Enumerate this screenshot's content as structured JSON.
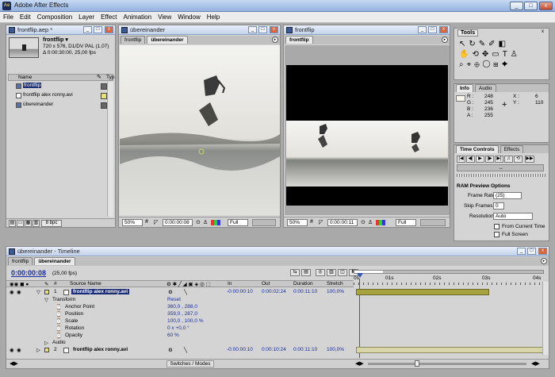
{
  "window": {
    "title": "Adobe After Effects",
    "icon": "ae-icon"
  },
  "menu": [
    "File",
    "Edit",
    "Composition",
    "Layer",
    "Effect",
    "Animation",
    "View",
    "Window",
    "Help"
  ],
  "project": {
    "title": "frontflip.aep *",
    "comp_name": "frontflip ▾",
    "info1": "720 x 576, D1/DV PAL (1,07)",
    "info2": "Δ 0:00:30:00, 25,00 fps",
    "col_name": "Name",
    "col_type": "Typ",
    "items": [
      "frontflip",
      "frontflip alex ronny.avi",
      "übereinander"
    ],
    "bpc": "8 bpc"
  },
  "comp1": {
    "title": "übereinander",
    "tabs": [
      "frontflip",
      "übereinander"
    ],
    "zoom": "50%",
    "timecode": "0:00:00:08",
    "res": "Full"
  },
  "comp2": {
    "title": "frontflip",
    "tabs": [
      "frontflip"
    ],
    "zoom": "50%",
    "timecode": "0:00:00:11",
    "res": "Full"
  },
  "tools": {
    "title": "Tools"
  },
  "info": {
    "tabs": [
      "Info",
      "Audio"
    ],
    "r": "R :",
    "rv": "248",
    "g": "G :",
    "gv": "245",
    "b": "B :",
    "bv": "236",
    "a": "A :",
    "av": "255",
    "x": "X :",
    "xv": "6",
    "y": "Y :",
    "yv": "110"
  },
  "time_controls": {
    "tabs": [
      "Time Controls",
      "Effects"
    ],
    "ram_title": "RAM Preview Options",
    "frame_rate_label": "Frame Rate:",
    "frame_rate": "(25)",
    "skip_label": "Skip Frames:",
    "skip": "0",
    "res_label": "Resolution:",
    "res": "Auto",
    "from_current": "From Current Time",
    "full_screen": "Full Screen"
  },
  "timeline": {
    "title": "übereinander - Timeline",
    "tabs": [
      "frontflip",
      "übereinander"
    ],
    "timecode": "0:00:00:08",
    "fps": "(25,00 fps)",
    "ruler": [
      "0s",
      "01s",
      "02s",
      "03s",
      "04s"
    ],
    "headers": {
      "num": "#",
      "src": "Source Name",
      "in": "In",
      "out": "Out",
      "dur": "Duration",
      "str": "Stretch"
    },
    "layers": [
      {
        "num": "1",
        "name": "frontflip alex ronny.avi",
        "in": "-0:00:00:10",
        "out": "0:00:02:24",
        "dur": "0:00:11:10",
        "str": "100,0%"
      },
      {
        "num": "2",
        "name": "frontflip alex ronny.avi",
        "in": "-0:00:00:10",
        "out": "0:00:10:24",
        "dur": "0:00:11:10",
        "str": "100,0%"
      }
    ],
    "transform": "Transform",
    "reset": "Reset",
    "props": [
      {
        "name": "Anchor Point",
        "value": "360,0 , 288,0"
      },
      {
        "name": "Position",
        "value": "359,0 , 287,0"
      },
      {
        "name": "Scale",
        "value": "100,0 , 100,0 %"
      },
      {
        "name": "Rotation",
        "value": "0 x +0,0 °"
      },
      {
        "name": "Opacity",
        "value": "60 %"
      }
    ],
    "audio": "Audio",
    "switches": "Switches / Modes"
  }
}
